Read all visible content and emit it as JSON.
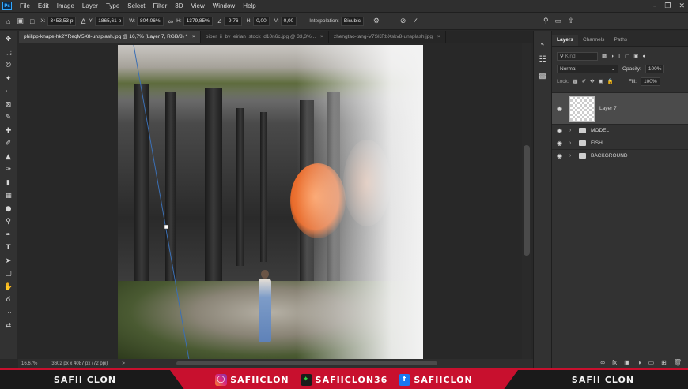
{
  "menubar": {
    "logo": "Ps",
    "items": [
      "File",
      "Edit",
      "Image",
      "Layer",
      "Type",
      "Select",
      "Filter",
      "3D",
      "View",
      "Window",
      "Help"
    ]
  },
  "options": {
    "x_label": "X:",
    "x_value": "3453,53 p",
    "y_label": "Y:",
    "y_value": "1865,61 p",
    "w_label": "W:",
    "w_value": "804,06%",
    "h_label": "H:",
    "h_value": "1379,85%",
    "angle_value": "-9,76",
    "hskew_label": "H:",
    "hskew_value": "0,00",
    "vskew_label": "V:",
    "vskew_value": "0,00",
    "interp_label": "Interpolation:",
    "interp_value": "Bicubic"
  },
  "tabs": [
    {
      "label": "philipp-knape-hk2YReqM5X8-unsplash.jpg @ 16,7% (Layer 7, RGB/8) *",
      "close": "×"
    },
    {
      "label": "piper_ii_by_eirian_stock_d10n6c.jpg @ 33,3%...",
      "close": "×"
    },
    {
      "label": "zhengtao-tang-V7SKRbXskv8-unsplash.jpg",
      "close": "×"
    }
  ],
  "status": {
    "zoom": "16,67%",
    "doc_info": "3602 px x 4087 px (72 ppi)",
    "arrow": ">"
  },
  "panel": {
    "tabs": [
      "Layers",
      "Channels",
      "Paths"
    ],
    "kind_placeholder": "Kind",
    "blend_mode": "Normal",
    "opacity_label": "Opacity:",
    "opacity_value": "100%",
    "lock_label": "Lock:",
    "fill_label": "Fill:",
    "fill_value": "100%",
    "layers": [
      {
        "name": "Layer 7"
      },
      {
        "name": "MODEL"
      },
      {
        "name": "FISH"
      },
      {
        "name": "BACKGROUND"
      }
    ]
  },
  "banner": {
    "left_text": "SAFII CLON",
    "instagram": "SAFIICLON",
    "other": "SAFIICLON36",
    "facebook": "SAFIICLON",
    "right_text": "SAFII CLON"
  },
  "colors": {
    "accent_red": "#c8102e",
    "ps_blue": "#31a8ff",
    "fish_orange": "#e86a2a"
  }
}
